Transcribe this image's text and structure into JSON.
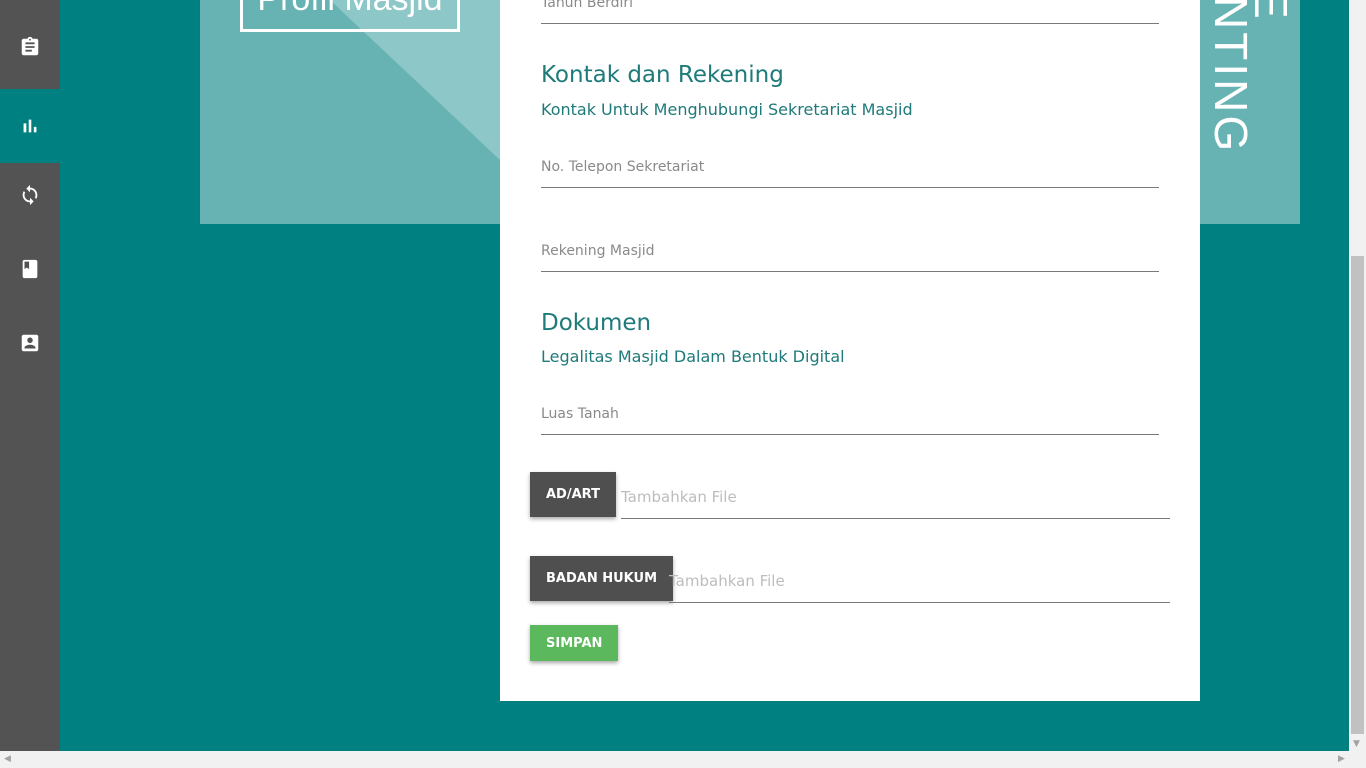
{
  "sidebar": {
    "items": [
      {
        "icon": "assignment-icon",
        "active": false
      },
      {
        "icon": "bar-chart-icon",
        "active": true
      },
      {
        "icon": "sync-icon",
        "active": false
      },
      {
        "icon": "book-icon",
        "active": false
      },
      {
        "icon": "contact-icon",
        "active": false
      }
    ]
  },
  "hero": {
    "title": "Profil Masjid",
    "side_text_1": "E",
    "side_text_2": "NTING"
  },
  "form": {
    "tahun_berdiri_placeholder": "Tahun Berdiri",
    "kontak": {
      "title": "Kontak dan Rekening",
      "subtitle": "Kontak Untuk Menghubungi Sekretariat Masjid",
      "telepon_placeholder": "No. Telepon Sekretariat",
      "rekening_placeholder": "Rekening Masjid"
    },
    "dokumen": {
      "title": "Dokumen",
      "subtitle": "Legalitas Masjid Dalam Bentuk Digital",
      "luas_tanah_placeholder": "Luas Tanah",
      "adart_button": "AD/ART",
      "adart_placeholder": "Tambahkan File",
      "badan_hukum_button": "BADAN HUKUM",
      "badan_hukum_placeholder": "Tambahkan File"
    },
    "save_button": "SIMPAN"
  },
  "colors": {
    "page_background": "#008080",
    "sidebar": "#535353",
    "accent_text": "#1f7a7a",
    "save_button": "#5cb85c",
    "file_button": "#4f4f4f"
  }
}
